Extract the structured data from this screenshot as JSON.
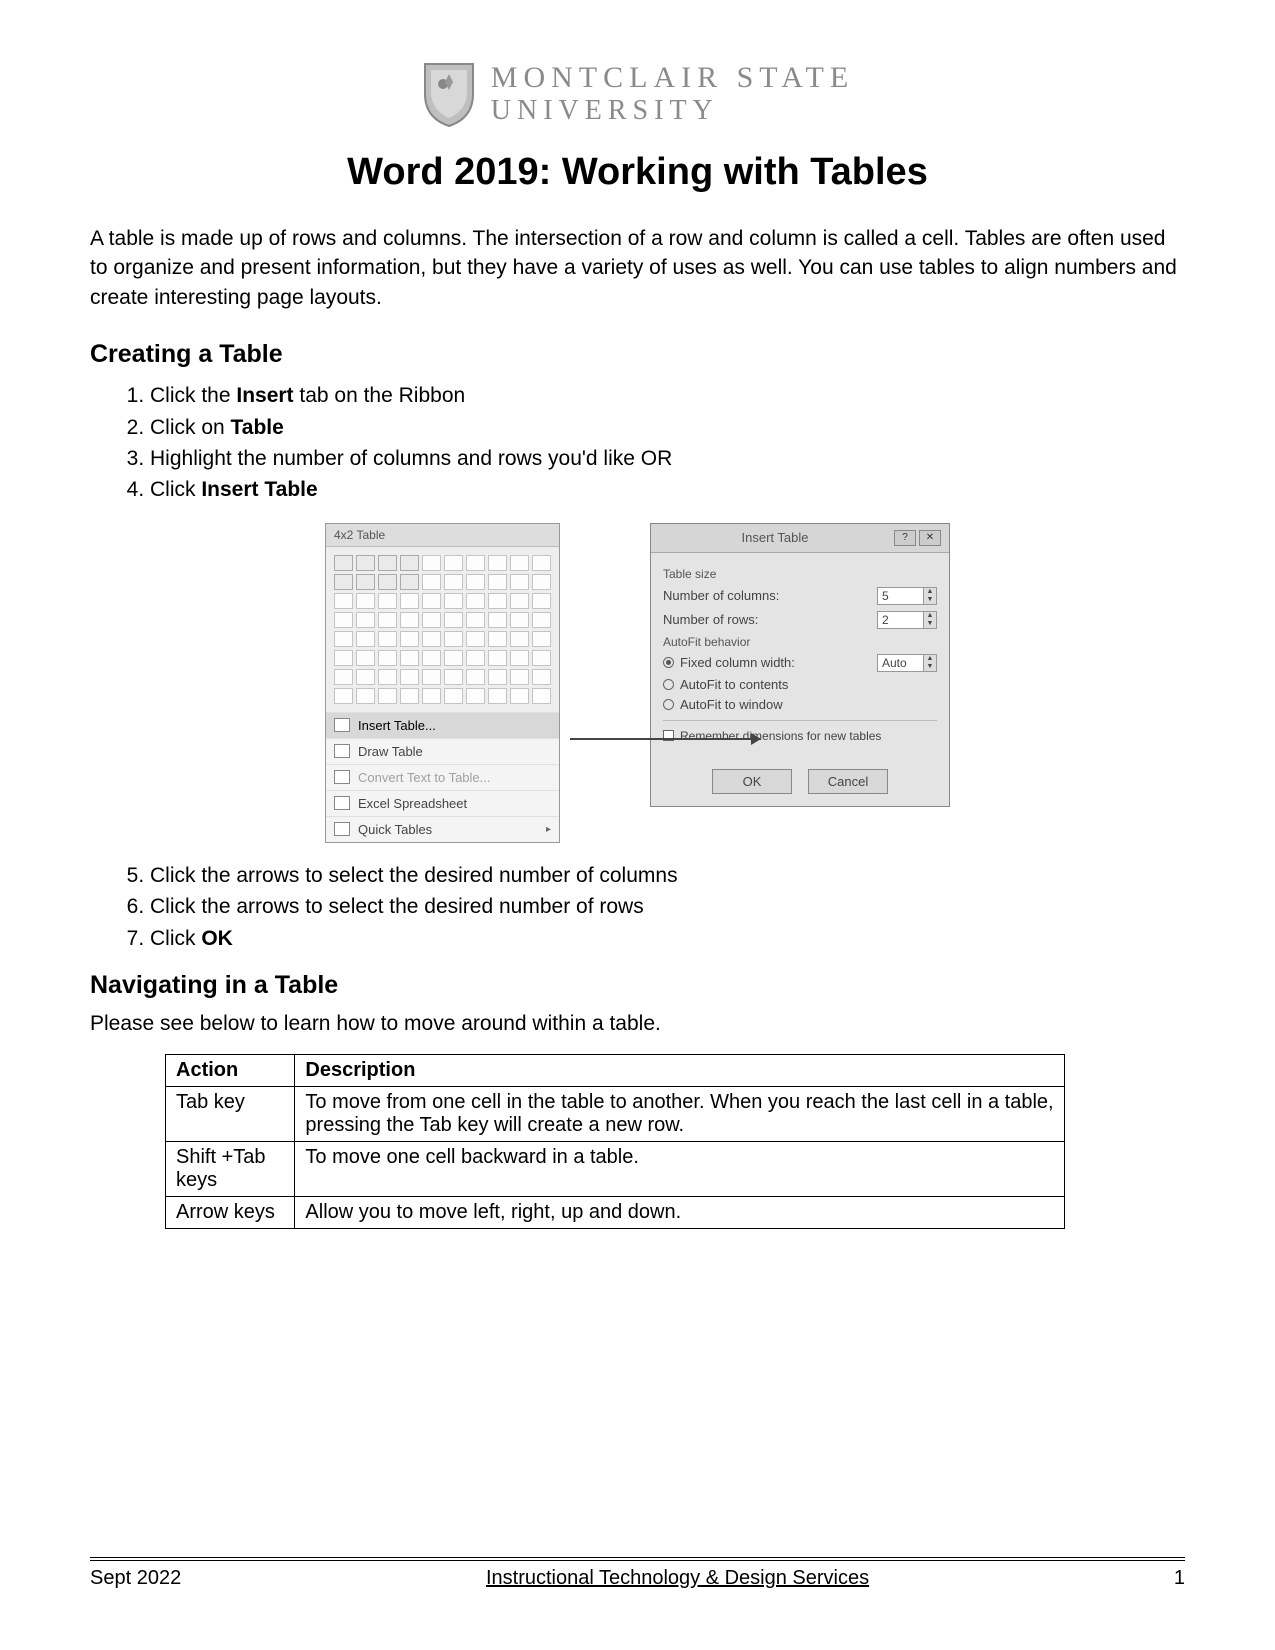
{
  "logo": {
    "line1": "MONTCLAIR STATE",
    "line2": "UNIVERSITY"
  },
  "title": "Word 2019: Working with Tables",
  "intro": "A table is made up of rows and columns. The intersection of a row and column is called a cell. Tables are often used to organize and present information, but they have a variety of uses as well. You can use tables to align numbers and create interesting page layouts.",
  "sections": {
    "creating_title": "Creating a Table",
    "navigating_title": "Navigating in a Table",
    "navigating_intro": "Please see below to learn how to move around within a table."
  },
  "steps_a_prefix": [
    "Click the ",
    "Click on ",
    "Highlight the number of columns and rows you'd like OR",
    "Click "
  ],
  "steps_a_bold": [
    "Insert",
    "Table",
    "",
    "Insert Table"
  ],
  "steps_a_suffix": [
    " tab on the Ribbon",
    "",
    "",
    ""
  ],
  "steps_b": [
    "Click the arrows to select the desired number of columns",
    "Click the arrows to select the desired number of rows",
    "Click "
  ],
  "steps_b_last_bold": "OK",
  "dropdown": {
    "header": "4x2 Table",
    "items": [
      "Insert Table...",
      "Draw Table",
      "Convert Text to Table...",
      "Excel Spreadsheet",
      "Quick Tables"
    ]
  },
  "dialog": {
    "title": "Insert Table",
    "section1": "Table size",
    "cols_label": "Number of columns:",
    "cols_value": "5",
    "rows_label": "Number of rows:",
    "rows_value": "2",
    "section2": "AutoFit behavior",
    "opt1": "Fixed column width:",
    "opt1_value": "Auto",
    "opt2": "AutoFit to contents",
    "opt3": "AutoFit to window",
    "remember": "Remember dimensions for new tables",
    "ok": "OK",
    "cancel": "Cancel"
  },
  "nav_table": {
    "headers": [
      "Action",
      "Description"
    ],
    "rows": [
      [
        "Tab key",
        "To move from one cell in the table to another. When you reach the last cell in a table, pressing the Tab key will create a new row."
      ],
      [
        "Shift +Tab keys",
        "To move one cell backward in a table."
      ],
      [
        "Arrow keys",
        "Allow you to move left, right, up and down."
      ]
    ]
  },
  "footer": {
    "left": "Sept 2022",
    "center": "Instructional Technology & Design Services",
    "right": "1"
  }
}
